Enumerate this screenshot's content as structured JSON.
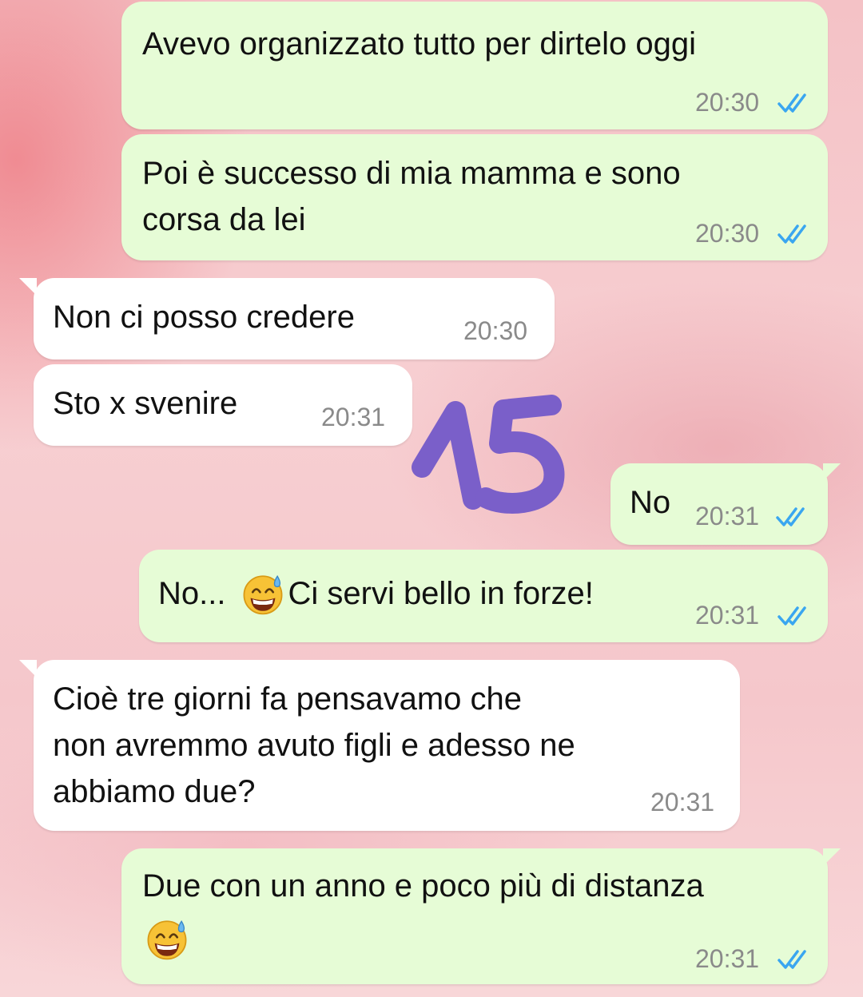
{
  "messages": [
    {
      "dir": "out",
      "text": "Avevo organizzato tutto per dirtelo oggi",
      "time": "20:30",
      "status": "read"
    },
    {
      "dir": "out",
      "text": "Poi è successo di mia mamma e sono\ncorsa da lei",
      "time": "20:30",
      "status": "read"
    },
    {
      "dir": "in",
      "text": "Non ci posso credere",
      "time": "20:30"
    },
    {
      "dir": "in",
      "text": "Sto x svenire",
      "time": "20:31"
    },
    {
      "dir": "out",
      "text": "No",
      "time": "20:31",
      "status": "read"
    },
    {
      "dir": "out",
      "text_before": "No...",
      "emoji": "grinning-sweat-emoji",
      "text_after": "Ci servi bello in forze!",
      "time": "20:31",
      "status": "read"
    },
    {
      "dir": "in",
      "text": "Cioè tre giorni fa pensavamo che\nnon avremmo avuto figli e adesso ne\nabbiamo due?",
      "time": "20:31"
    },
    {
      "dir": "out",
      "text": "Due con un anno e poco più di distanza",
      "emoji": "grinning-sweat-emoji",
      "time": "20:31",
      "status": "read"
    }
  ],
  "overlay": {
    "label": "15",
    "color": "#7a5fc9"
  },
  "colors": {
    "outgoing_bubble": "#e6fcd6",
    "incoming_bubble": "#ffffff",
    "read_ticks": "#3aa6f0"
  }
}
